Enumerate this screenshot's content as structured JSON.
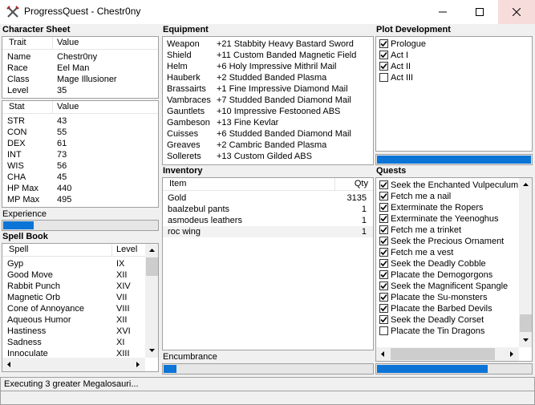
{
  "window": {
    "title": "ProgressQuest - Chestr0ny",
    "app_icon": "crossed-swords-icon"
  },
  "character_sheet": {
    "title": "Character Sheet",
    "trait_header": [
      "Trait",
      "Value"
    ],
    "traits": [
      {
        "name": "Name",
        "value": "Chestr0ny"
      },
      {
        "name": "Race",
        "value": "Eel Man"
      },
      {
        "name": "Class",
        "value": "Mage Illusioner"
      },
      {
        "name": "Level",
        "value": "35"
      }
    ],
    "stat_header": [
      "Stat",
      "Value"
    ],
    "stats": [
      {
        "name": "STR",
        "value": "43"
      },
      {
        "name": "CON",
        "value": "55"
      },
      {
        "name": "DEX",
        "value": "61"
      },
      {
        "name": "INT",
        "value": "73"
      },
      {
        "name": "WIS",
        "value": "56"
      },
      {
        "name": "CHA",
        "value": "45"
      },
      {
        "name": "HP Max",
        "value": "440"
      },
      {
        "name": "MP Max",
        "value": "495"
      }
    ],
    "experience_label": "Experience",
    "experience_progress": 0.2
  },
  "spell_book": {
    "title": "Spell Book",
    "header": [
      "Spell",
      "Level"
    ],
    "spells": [
      {
        "name": "Gyp",
        "level": "IX"
      },
      {
        "name": "Good Move",
        "level": "XII"
      },
      {
        "name": "Rabbit Punch",
        "level": "XIV"
      },
      {
        "name": "Magnetic Orb",
        "level": "VII"
      },
      {
        "name": "Cone of Annoyance",
        "level": "VIII"
      },
      {
        "name": "Aqueous Humor",
        "level": "XII"
      },
      {
        "name": "Hastiness",
        "level": "XVI"
      },
      {
        "name": "Sadness",
        "level": "XI"
      },
      {
        "name": "Innoculate",
        "level": "XIII"
      }
    ]
  },
  "equipment": {
    "title": "Equipment",
    "items": [
      {
        "slot": "Weapon",
        "item": "+21 Stabbity Heavy Bastard Sword"
      },
      {
        "slot": "Shield",
        "item": "+11 Custom Banded Magnetic Field"
      },
      {
        "slot": "Helm",
        "item": "+6 Holy Impressive Mithril Mail"
      },
      {
        "slot": "Hauberk",
        "item": "+2 Studded Banded Plasma"
      },
      {
        "slot": "Brassairts",
        "item": "+1 Fine Impressive Diamond Mail"
      },
      {
        "slot": "Vambraces",
        "item": "+7 Studded Banded Diamond Mail"
      },
      {
        "slot": "Gauntlets",
        "item": "+10 Impressive Festooned ABS"
      },
      {
        "slot": "Gambeson",
        "item": "+13 Fine Kevlar"
      },
      {
        "slot": "Cuisses",
        "item": "+6 Studded Banded Diamond Mail"
      },
      {
        "slot": "Greaves",
        "item": "+2 Cambric Banded Plasma"
      },
      {
        "slot": "Sollerets",
        "item": "+13 Custom Gilded ABS"
      }
    ]
  },
  "inventory": {
    "title": "Inventory",
    "header": [
      "Item",
      "Qty"
    ],
    "items": [
      {
        "name": "Gold",
        "qty": "3135"
      },
      {
        "name": "baalzebul pants",
        "qty": "1"
      },
      {
        "name": "asmodeus leathers",
        "qty": "1"
      },
      {
        "name": "roc wing",
        "qty": "1"
      }
    ],
    "encumbrance_label": "Encumbrance",
    "encumbrance_progress": 0.06
  },
  "plot": {
    "title": "Plot Development",
    "acts": [
      {
        "label": "Prologue",
        "checked": true
      },
      {
        "label": "Act I",
        "checked": true
      },
      {
        "label": "Act II",
        "checked": true
      },
      {
        "label": "Act III",
        "checked": false
      }
    ],
    "progress": 1.0
  },
  "quests": {
    "title": "Quests",
    "items": [
      {
        "label": "Seek the Enchanted Vulpeculum",
        "checked": true
      },
      {
        "label": "Fetch me a nail",
        "checked": true
      },
      {
        "label": "Exterminate the Ropers",
        "checked": true
      },
      {
        "label": "Exterminate the Yeenoghus",
        "checked": true
      },
      {
        "label": "Fetch me a trinket",
        "checked": true
      },
      {
        "label": "Seek the Precious Ornament",
        "checked": true
      },
      {
        "label": "Fetch me a vest",
        "checked": true
      },
      {
        "label": "Seek the Deadly Cobble",
        "checked": true
      },
      {
        "label": "Placate the Demogorgons",
        "checked": true
      },
      {
        "label": "Seek the Magnificent Spangle",
        "checked": true
      },
      {
        "label": "Placate the Su-monsters",
        "checked": true
      },
      {
        "label": "Placate the Barbed Devils",
        "checked": true
      },
      {
        "label": "Seek the Deadly Corset",
        "checked": true
      },
      {
        "label": "Placate the Tin Dragons",
        "checked": false
      }
    ],
    "progress": 0.72
  },
  "status": {
    "task": "Executing 3 greater Megalosauri...",
    "task_progress": 0.0
  }
}
